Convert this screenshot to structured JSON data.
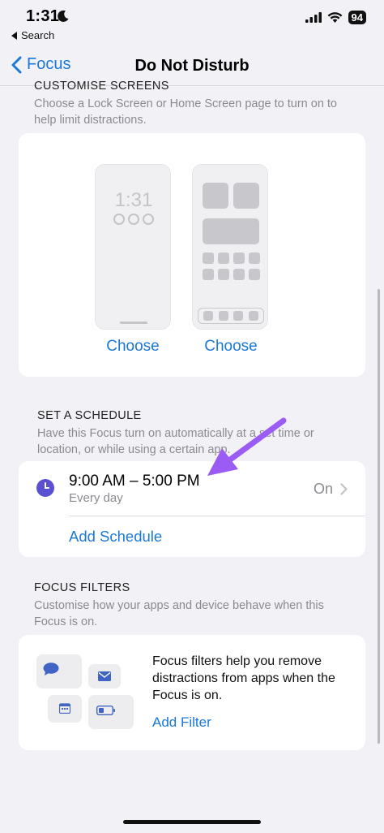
{
  "status_bar": {
    "time": "1:31",
    "back_app_label": "Search",
    "battery": "94"
  },
  "nav": {
    "back_label": "Focus",
    "title": "Do Not Disturb"
  },
  "customise": {
    "header": "CUSTOMISE SCREENS",
    "description": "Choose a Lock Screen or Home Screen page to turn on to help limit distractions.",
    "lock_preview_time": "1:31",
    "lock_choose_label": "Choose",
    "home_choose_label": "Choose"
  },
  "schedule": {
    "header": "SET A SCHEDULE",
    "description": "Have this Focus turn on automatically at a set time or location, or while using a certain app.",
    "item_time": "9:00 AM – 5:00 PM",
    "item_repeat": "Every day",
    "item_state": "On",
    "add_label": "Add Schedule"
  },
  "filters": {
    "header": "FOCUS FILTERS",
    "description": "Customise how your apps and device behave when this Focus is on.",
    "card_text": "Focus filters help you remove distractions from apps when the Focus is on.",
    "add_label": "Add Filter"
  },
  "colors": {
    "accent": "#1a78d6",
    "focus_purple": "#5b4fd4",
    "annotation_arrow": "#9b5cf6"
  }
}
